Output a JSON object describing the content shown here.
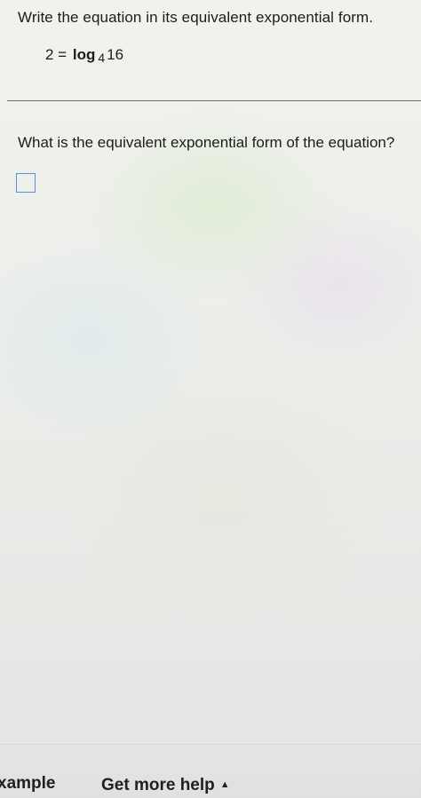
{
  "question": {
    "instruction": "Write the equation in its equivalent exponential form.",
    "equation": {
      "lhs": "2 =",
      "log_word": "log",
      "base": "4",
      "argument": "16"
    }
  },
  "prompt": "What is the equivalent exponential form of the equation?",
  "answer": {
    "value": ""
  },
  "footer": {
    "example_label": "xample",
    "help_label": "Get more help",
    "help_caret": "▲"
  },
  "colors": {
    "answer_box_border": "#5b8ed6",
    "text": "#1c1c1c"
  }
}
